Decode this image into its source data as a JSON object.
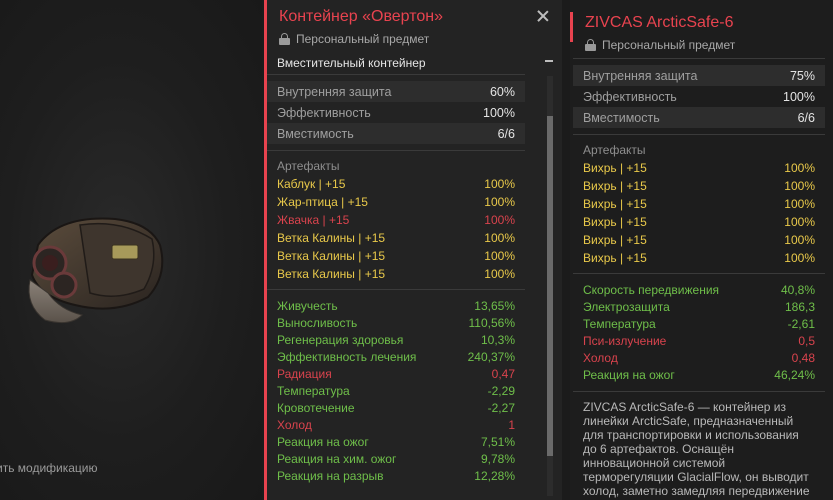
{
  "preview": {
    "mod_hint": "ить модификацию"
  },
  "left": {
    "title": "Контейнер «Овертон»",
    "subtitle": "Персональный предмет",
    "capacity_label": "Вместительный контейнер",
    "stats": [
      {
        "label": "Внутренняя защита",
        "value": "60%"
      },
      {
        "label": "Эффективность",
        "value": "100%"
      },
      {
        "label": "Вместимость",
        "value": "6/6"
      }
    ],
    "artifacts_title": "Артефакты",
    "artifacts": [
      {
        "label": "Каблук | +15",
        "value": "100%",
        "tone": "yellow"
      },
      {
        "label": "Жар-птица | +15",
        "value": "100%",
        "tone": "yellow"
      },
      {
        "label": "Жвачка | +15",
        "value": "100%",
        "tone": "red"
      },
      {
        "label": "Ветка Калины | +15",
        "value": "100%",
        "tone": "yellow"
      },
      {
        "label": "Ветка Калины | +15",
        "value": "100%",
        "tone": "yellow"
      },
      {
        "label": "Ветка Калины | +15",
        "value": "100%",
        "tone": "yellow"
      }
    ],
    "effects": [
      {
        "label": "Живучесть",
        "value": "13,65%",
        "tone": "green"
      },
      {
        "label": "Выносливость",
        "value": "110,56%",
        "tone": "green"
      },
      {
        "label": "Регенерация здоровья",
        "value": "10,3%",
        "tone": "green"
      },
      {
        "label": "Эффективность лечения",
        "value": "240,37%",
        "tone": "green"
      },
      {
        "label": "Радиация",
        "value": "0,47",
        "tone": "red"
      },
      {
        "label": "Температура",
        "value": "-2,29",
        "tone": "green"
      },
      {
        "label": "Кровотечение",
        "value": "-2,27",
        "tone": "green"
      },
      {
        "label": "Холод",
        "value": "1",
        "tone": "red"
      },
      {
        "label": "Реакция на ожог",
        "value": "7,51%",
        "tone": "green"
      },
      {
        "label": "Реакция на хим. ожог",
        "value": "9,78%",
        "tone": "green"
      },
      {
        "label": "Реакция на разрыв",
        "value": "12,28%",
        "tone": "green"
      }
    ]
  },
  "right": {
    "title": "ZIVCAS ArcticSafe-6",
    "subtitle": "Персональный предмет",
    "stats": [
      {
        "label": "Внутренняя защита",
        "value": "75%"
      },
      {
        "label": "Эффективность",
        "value": "100%"
      },
      {
        "label": "Вместимость",
        "value": "6/6"
      }
    ],
    "artifacts_title": "Артефакты",
    "artifacts": [
      {
        "label": "Вихрь | +15",
        "value": "100%",
        "tone": "yellow"
      },
      {
        "label": "Вихрь | +15",
        "value": "100%",
        "tone": "yellow"
      },
      {
        "label": "Вихрь | +15",
        "value": "100%",
        "tone": "yellow"
      },
      {
        "label": "Вихрь | +15",
        "value": "100%",
        "tone": "yellow"
      },
      {
        "label": "Вихрь | +15",
        "value": "100%",
        "tone": "yellow"
      },
      {
        "label": "Вихрь | +15",
        "value": "100%",
        "tone": "yellow"
      }
    ],
    "effects": [
      {
        "label": "Скорость передвижения",
        "value": "40,8%",
        "tone": "green"
      },
      {
        "label": "Электрозащита",
        "value": "186,3",
        "tone": "green"
      },
      {
        "label": "Температура",
        "value": "-2,61",
        "tone": "green"
      },
      {
        "label": "Пси-излучение",
        "value": "0,5",
        "tone": "red"
      },
      {
        "label": "Холод",
        "value": "0,48",
        "tone": "red"
      },
      {
        "label": "Реакция на ожог",
        "value": "46,24%",
        "tone": "green"
      }
    ],
    "description": "ZIVCAS ArcticSafe-6 — контейнер из линейки ArcticSafe, предназначенный для транспортировки и использования до 6 артефактов. Оснащён инновационной системой терморегуляции GlacialFlow, он выводит холод, заметно замедляя передвижение"
  },
  "colors": {
    "accent": "#e8434f",
    "artifact_yellow": "#e9c94a",
    "positive_green": "#6fbf4a",
    "negative_red": "#d9434d"
  },
  "icons": [
    "lock-icon",
    "close-icon",
    "scroll-up-icon"
  ]
}
